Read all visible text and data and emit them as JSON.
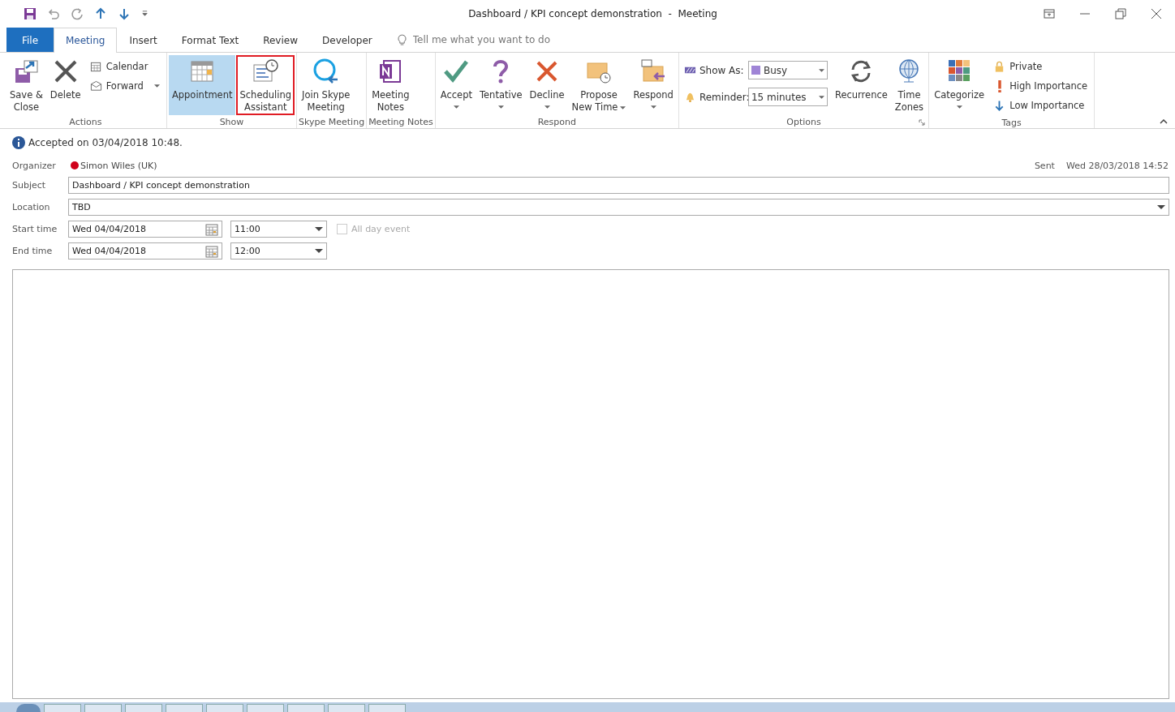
{
  "window": {
    "title": "Dashboard / KPI concept demonstration  -  Meeting"
  },
  "tabs": [
    {
      "label": "File",
      "kind": "file",
      "selected": false
    },
    {
      "label": "Meeting",
      "kind": "tab",
      "selected": true
    },
    {
      "label": "Insert",
      "kind": "tab",
      "selected": false
    },
    {
      "label": "Format Text",
      "kind": "tab",
      "selected": false
    },
    {
      "label": "Review",
      "kind": "tab",
      "selected": false
    },
    {
      "label": "Developer",
      "kind": "tab",
      "selected": false
    }
  ],
  "search": {
    "placeholder": "Tell me what you want to do"
  },
  "ribbon": {
    "groups": [
      {
        "label": "Actions",
        "items": [
          {
            "kind": "large",
            "lines": [
              "Save &",
              "Close"
            ]
          },
          {
            "kind": "large",
            "lines": [
              "Delete"
            ]
          },
          {
            "kind": "small",
            "lines": [
              "Calendar"
            ]
          },
          {
            "kind": "small",
            "lines": [
              "Forward"
            ],
            "menu": true
          }
        ]
      },
      {
        "label": "Show",
        "items": [
          {
            "kind": "large",
            "lines": [
              "Appointment"
            ],
            "selected": true
          },
          {
            "kind": "large",
            "lines": [
              "Scheduling",
              "Assistant"
            ],
            "selected": false,
            "outlined": true
          }
        ]
      },
      {
        "label": "Skype Meeting",
        "items": [
          {
            "kind": "large",
            "lines": [
              "Join Skype",
              "Meeting"
            ]
          }
        ]
      },
      {
        "label": "Meeting Notes",
        "items": [
          {
            "kind": "large",
            "lines": [
              "Meeting",
              "Notes"
            ]
          }
        ]
      },
      {
        "label": "Respond",
        "items": [
          {
            "kind": "large",
            "lines": [
              "Accept"
            ],
            "menu": true
          },
          {
            "kind": "large",
            "lines": [
              "Tentative"
            ],
            "menu": true
          },
          {
            "kind": "large",
            "lines": [
              "Decline"
            ],
            "menu": true
          },
          {
            "kind": "large",
            "lines": [
              "Propose",
              "New Time"
            ],
            "menu": true
          },
          {
            "kind": "large",
            "lines": [
              "Respond"
            ],
            "menu": true
          }
        ]
      },
      {
        "label": "Options",
        "launcher": true,
        "items": [
          {
            "kind": "combo",
            "lines": [
              "Show As:"
            ],
            "value": "Busy"
          },
          {
            "kind": "combo",
            "lines": [
              "Reminder:"
            ],
            "value": "15 minutes"
          },
          {
            "kind": "large",
            "lines": [
              "Recurrence"
            ]
          },
          {
            "kind": "large",
            "lines": [
              "Time",
              "Zones"
            ]
          }
        ]
      },
      {
        "label": "Tags",
        "items": [
          {
            "kind": "large",
            "lines": [
              "Categorize"
            ],
            "menu": true
          },
          {
            "kind": "small",
            "lines": [
              "Private"
            ]
          },
          {
            "kind": "small",
            "lines": [
              "High Importance"
            ]
          },
          {
            "kind": "small",
            "lines": [
              "Low Importance"
            ]
          }
        ]
      }
    ]
  },
  "info": "Accepted on 03/04/2018 10:48.",
  "organizer": {
    "label": "Organizer",
    "name": "Simon Wiles (UK)",
    "color": "#d0021b"
  },
  "sent": {
    "label": "Sent",
    "value": "Wed 28/03/2018 14:52"
  },
  "subject": {
    "label": "Subject",
    "value": "Dashboard / KPI concept demonstration"
  },
  "location": {
    "label": "Location",
    "value": "TBD"
  },
  "start": {
    "label": "Start time",
    "date": "Wed 04/04/2018",
    "time": "11:00"
  },
  "end": {
    "label": "End time",
    "date": "Wed 04/04/2018",
    "time": "12:00"
  },
  "all_day": {
    "label": "All day event",
    "checked": false,
    "disabled": true
  }
}
